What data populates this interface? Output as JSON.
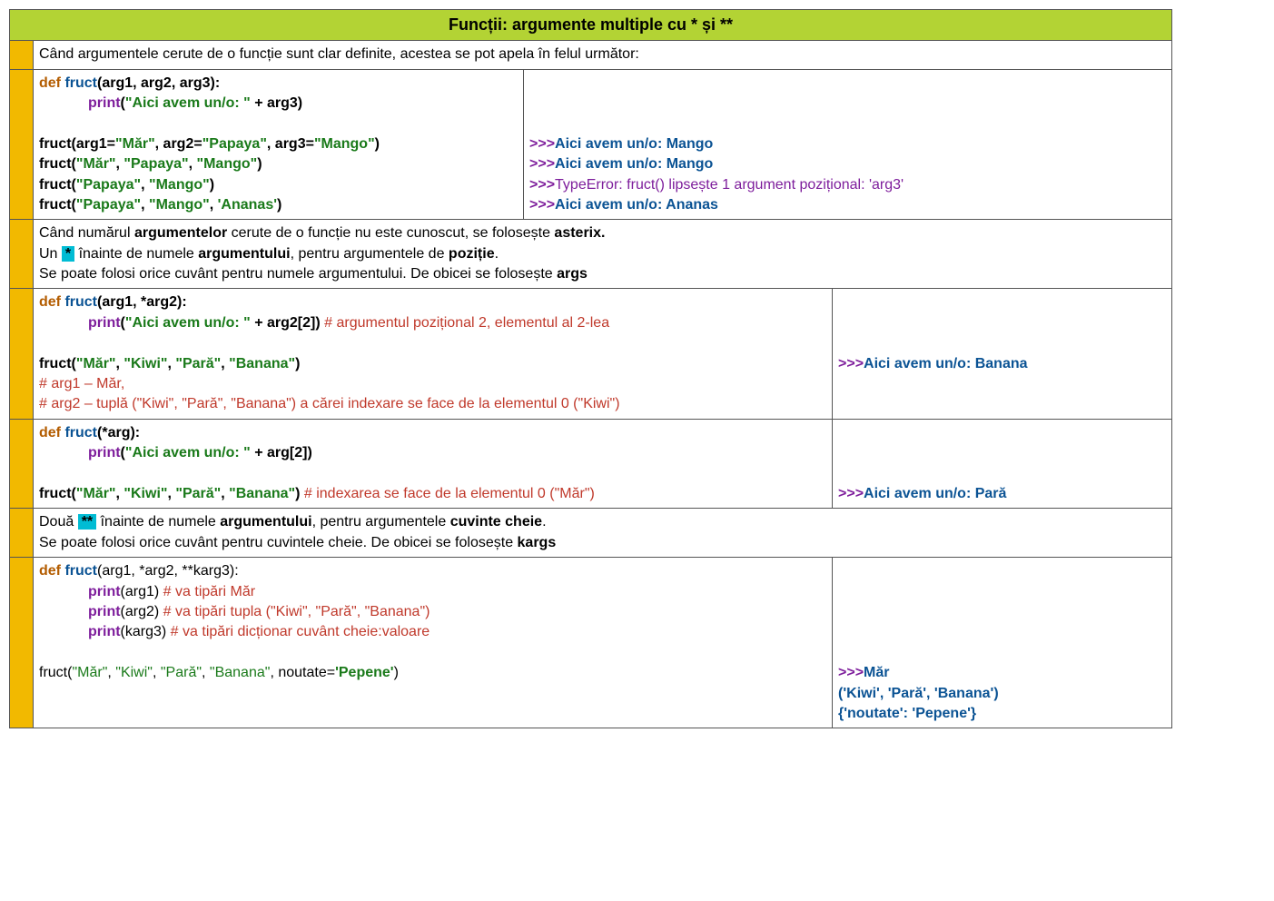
{
  "title": "Funcții: argumente multiple cu * și **",
  "r1": {
    "text": "Când argumentele cerute de o funcție sunt clar definite, acestea se pot apela în felul următor:"
  },
  "r2": {
    "def": "def ",
    "fn": "fruct",
    "sig": "(arg1, arg2, arg3):",
    "pln": "print",
    "po": "(",
    "pstr": "\"Aici avem un/o: \"",
    "pcat": " + arg3)",
    "c1a": "fruct(arg1=",
    "c1s1": "\"Măr\"",
    "c1b": ",  arg2=",
    "c1s2": "\"Papaya\"",
    "c1c": ", arg3=",
    "c1s3": "\"Mango\"",
    "c1d": ")",
    "c2a": "fruct(",
    "c2s1": "\"Măr\"",
    "c2b": ",  ",
    "c2s2": "\"Papaya\"",
    "c2c": ", ",
    "c2s3": "\"Mango\"",
    "c2d": ")",
    "c3a": "fruct(",
    "c3s1": "\"Papaya\"",
    "c3b": ", ",
    "c3s2": "\"Mango\"",
    "c3c": ")",
    "c4a": "fruct(",
    "c4s1": "\"Papaya\"",
    "c4b": ", ",
    "c4s2": "\"Mango\"",
    "c4c": ", ",
    "c4s3": "'Ananas'",
    "c4d": ")",
    "o_p": ">>>",
    "o1": "Aici avem un/o: Mango",
    "o2": "Aici avem un/o: Mango",
    "o3": "TypeError: fruct() lipsește 1 argument pozițional: 'arg3'",
    "o4": "Aici avem un/o: Ananas"
  },
  "r3": {
    "l1a": "Când numărul ",
    "l1b": "argumentelor",
    "l1c": " cerute de o funcție nu este cunoscut, se folosește ",
    "l1d": "asterix.",
    "l2a": "Un ",
    "ast": "*",
    "l2b": " înainte de numele ",
    "l2c": "argumentului",
    "l2d": ", pentru argumentele de ",
    "l2e": "poziție",
    "l2f": ".",
    "l3a": "Se poate folosi orice cuvânt pentru numele argumentului. De obicei se folosește ",
    "l3b": "args"
  },
  "r4": {
    "def": "def ",
    "fn": "fruct",
    "sig": "(arg1, *arg2):",
    "pln": "print",
    "po": "(",
    "pstr": "\"Aici avem un/o: \"",
    "pcat": " + arg2[2])",
    "pcom": "   # argumentul pozițional 2, elementul al 2-lea",
    "c1a": "fruct(",
    "c1s1": "\"Măr\"",
    "c1b": ",  ",
    "c1s2": "\"Kiwi\"",
    "c1c": ", ",
    "c1s3": "\"Pară\"",
    "c1d": ", ",
    "c1s4": "\"Banana\"",
    "c1e": ")",
    "cm1": "# arg1 – Măr,",
    "cm2": "# arg2 – tuplă (\"Kiwi\", \"Pară\", \"Banana\") a cărei indexare se face de la elementul  0 (\"Kiwi\")",
    "o_p": ">>>",
    "o1": "Aici avem un/o: Banana"
  },
  "r5": {
    "def": "def ",
    "fn": "fruct",
    "sig": "(*arg):",
    "pln": "print",
    "po": "(",
    "pstr": "\"Aici avem un/o: \"",
    "pcat": " + arg[2])",
    "c1a": "fruct(",
    "c1s1": "\"Măr\"",
    "c1b": ",  ",
    "c1s2": "\"Kiwi\"",
    "c1c": ", ",
    "c1s3": "\"Pară\"",
    "c1d": ", ",
    "c1s4": "\"Banana\"",
    "c1e": ")",
    "c1com": "   # indexarea se face de la elementul 0 (\"Măr\")",
    "o_p": ">>>",
    "o1": "Aici avem un/o: Pară"
  },
  "r6": {
    "l1a": "Două ",
    "ast": "**",
    "l1b": " înainte de numele ",
    "l1c": "argumentului",
    "l1d": ", pentru argumentele ",
    "l1e": "cuvinte cheie",
    "l1f": ".",
    "l2a": "Se poate folosi orice cuvânt pentru cuvintele cheie. De obicei se folosește ",
    "l2b": "kargs"
  },
  "r7": {
    "def": "def ",
    "fn": "fruct",
    "sig": "(arg1, *arg2, **karg3):",
    "pln": "print",
    "p1": "(arg1)",
    "c1": "     # va tipări Măr",
    "p2": "(arg2)",
    "c2": "     # va tipări tupla (\"Kiwi\", \"Pară\", \"Banana\")",
    "p3": "(karg3)",
    "c3": "    # va tipări dicționar cuvânt cheie:valoare",
    "calla": "fruct(",
    "s1": "\"Măr\"",
    "cb": ",  ",
    "s2": "\"Kiwi\"",
    "cc": ", ",
    "s3": "\"Pară\"",
    "cd": ", ",
    "s4": "\"Banana\"",
    "ce": ", noutate=",
    "s5": "'Pepene'",
    "cf": ")",
    "o_p": ">>>",
    "o1": "Măr",
    "o2": "('Kiwi', 'Pară', 'Banana')",
    "o3": "{'noutate': 'Pepene'}"
  }
}
